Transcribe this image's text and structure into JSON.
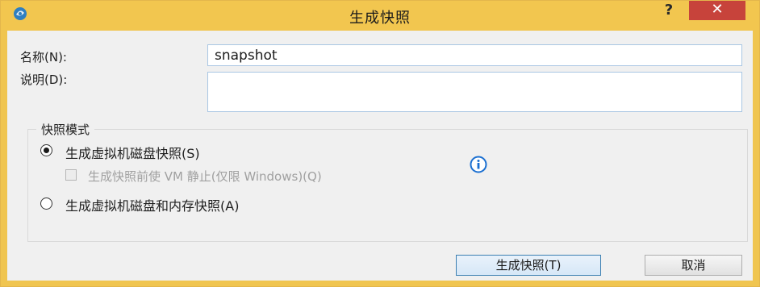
{
  "window": {
    "title": "生成快照",
    "help_label": "?",
    "close_label": "✕"
  },
  "form": {
    "name_label": "名称(N):",
    "name_value": "snapshot",
    "description_label": "说明(D):",
    "description_value": ""
  },
  "mode_group": {
    "title": "快照模式",
    "option_disk": {
      "label": "生成虚拟机磁盘快照(S)",
      "selected": true
    },
    "quiesce_checkbox": {
      "label": "生成快照前使 VM 静止(仅限 Windows)(Q)",
      "checked": false,
      "enabled": false
    },
    "option_disk_memory": {
      "label": "生成虚拟机磁盘和内存快照(A)",
      "selected": false
    },
    "info_icon": "info-icon"
  },
  "buttons": {
    "ok_label": "生成快照(T)",
    "cancel_label": "取消"
  },
  "colors": {
    "titlebar": "#f2c64f",
    "close_button": "#c7433b",
    "info_blue": "#1a6fd1"
  }
}
